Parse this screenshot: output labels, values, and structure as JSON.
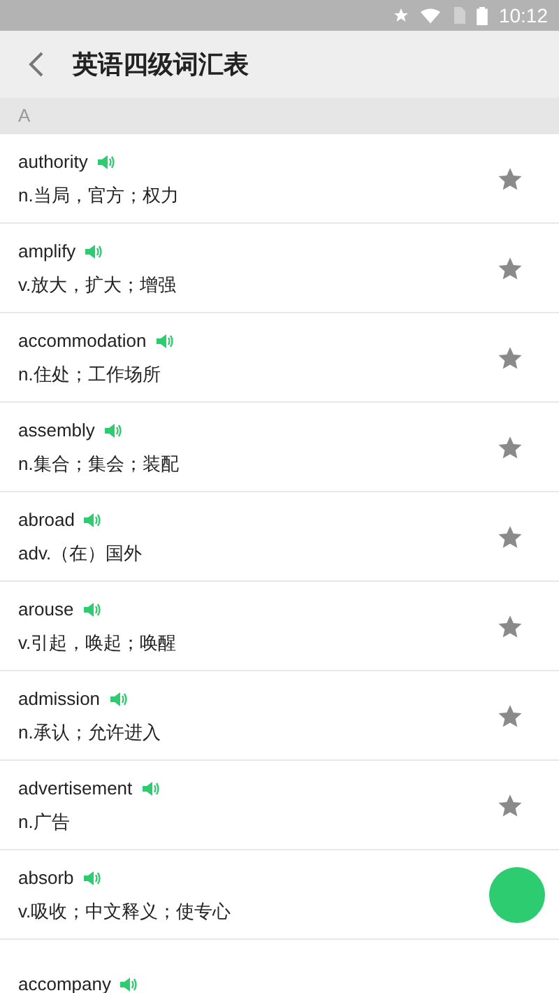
{
  "status_bar": {
    "time": "10:12"
  },
  "header": {
    "title": "英语四级词汇表"
  },
  "section": {
    "letter": "A"
  },
  "words": [
    {
      "word": "authority",
      "meaning": "n.当局，官方；权力",
      "starred": false
    },
    {
      "word": "amplify",
      "meaning": "v.放大，扩大；增强",
      "starred": false
    },
    {
      "word": "accommodation",
      "meaning": "n.住处；工作场所",
      "starred": false
    },
    {
      "word": "assembly",
      "meaning": "n.集合；集会；装配",
      "starred": false
    },
    {
      "word": "abroad",
      "meaning": "adv.（在）国外",
      "starred": false
    },
    {
      "word": "arouse",
      "meaning": "v.引起，唤起；唤醒",
      "starred": false
    },
    {
      "word": "admission",
      "meaning": "n.承认；允许进入",
      "starred": false
    },
    {
      "word": "advertisement",
      "meaning": "n.广告",
      "starred": false
    },
    {
      "word": "absorb",
      "meaning": "v.吸收；中文释义；使专心"
    },
    {
      "word": "accompany"
    }
  ]
}
